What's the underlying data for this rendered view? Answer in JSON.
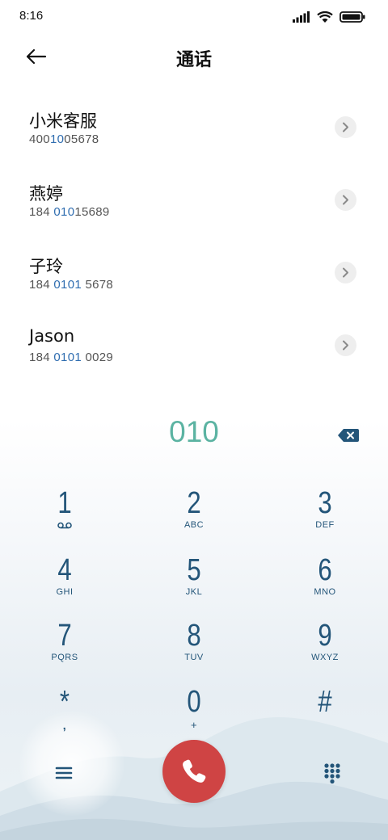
{
  "status_bar": {
    "time": "8:16",
    "icons": [
      "signal-icon",
      "wifi-icon",
      "battery-icon"
    ]
  },
  "header": {
    "back_icon": "arrow-left-icon",
    "title": "通话"
  },
  "contacts": [
    {
      "name": "小米客服",
      "number_parts": [
        "400",
        "10",
        "05678"
      ],
      "chevron": "chevron-right-icon"
    },
    {
      "name": "燕婷",
      "number_parts": [
        "184 ",
        "010",
        "15689"
      ],
      "chevron": "chevron-right-icon"
    },
    {
      "name": "子玲",
      "number_parts": [
        "184 ",
        "0101",
        " 5678"
      ],
      "chevron": "chevron-right-icon"
    },
    {
      "name": "Jason",
      "number_parts": [
        "184 ",
        "0101",
        " 0029"
      ],
      "chevron": "chevron-right-icon"
    }
  ],
  "dial_display": {
    "number": "010",
    "backspace_icon": "backspace-icon"
  },
  "keypad": [
    {
      "digit": "1",
      "letters": "",
      "sub_icon": "voicemail-icon"
    },
    {
      "digit": "2",
      "letters": "ABC"
    },
    {
      "digit": "3",
      "letters": "DEF"
    },
    {
      "digit": "4",
      "letters": "GHI"
    },
    {
      "digit": "5",
      "letters": "JKL"
    },
    {
      "digit": "6",
      "letters": "MNO"
    },
    {
      "digit": "7",
      "letters": "PQRS"
    },
    {
      "digit": "8",
      "letters": "TUV"
    },
    {
      "digit": "9",
      "letters": "WXYZ"
    },
    {
      "digit": "*",
      "letters": ","
    },
    {
      "digit": "0",
      "letters": "+"
    },
    {
      "digit": "#",
      "letters": ""
    }
  ],
  "bottom_bar": {
    "menu_icon": "menu-icon",
    "call_icon": "phone-icon",
    "dialpad_icon": "dialpad-icon"
  },
  "colors": {
    "accent_number": "#5bb3a2",
    "key_text": "#235579",
    "call_button": "#cf4444",
    "highlight": "#2f6db0"
  }
}
